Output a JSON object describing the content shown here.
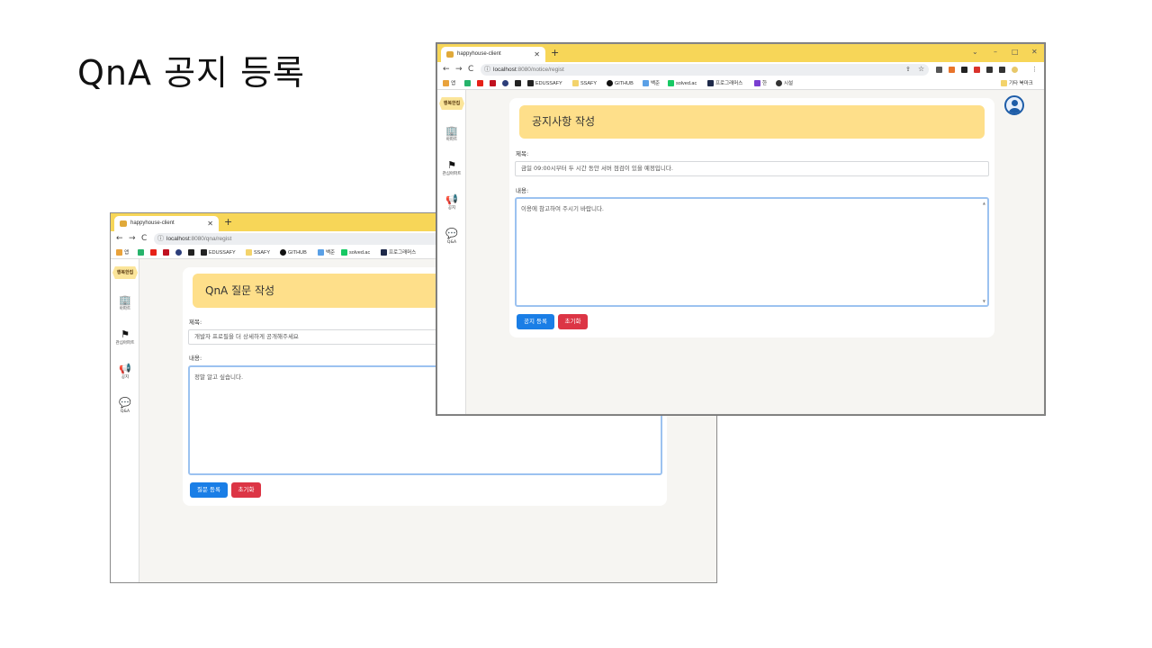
{
  "slide": {
    "title": "QnA 공지 등록"
  },
  "colors": {
    "tab_bar": "#f7d658",
    "card_header": "#fedf8a",
    "primary": "#1a7ee6",
    "danger": "#dc3545",
    "page_bg": "#f6f5f2"
  },
  "qna_window": {
    "tab_title": "happyhouse-client",
    "url_host": "localhost",
    "url_path": ":8080/qna/regist",
    "bookmarks": [
      "앱",
      "EDUSSAFY",
      "SSAFY",
      "GITHUB",
      "백준",
      "solved.ac",
      "프로그래머스"
    ],
    "sidebar": {
      "logo": "행복한집",
      "items": [
        "아파트",
        "관심아파트",
        "공지",
        "Q&A"
      ]
    },
    "form": {
      "header": "QnA 질문 작성",
      "title_label": "제목:",
      "title_value": "개발자 프로필을 더 상세하게 공개해주세요",
      "content_label": "내용:",
      "content_value": "정말 알고 싶습니다.",
      "submit_label": "질문 등록",
      "reset_label": "초기화"
    }
  },
  "notice_window": {
    "tab_title": "happyhouse-client",
    "url_host": "localhost",
    "url_path": ":8080/notice/regist",
    "bookmarks": [
      "앱",
      "EDUSSAFY",
      "SSAFY",
      "GITHUB",
      "백준",
      "solved.ac",
      "프로그래머스",
      "한",
      "시설"
    ],
    "other_bookmarks": "기타 북마크",
    "sidebar": {
      "logo": "행복한집",
      "items": [
        "아파트",
        "관심아파트",
        "공지",
        "Q&A"
      ]
    },
    "form": {
      "header": "공지사항 작성",
      "title_label": "제목:",
      "title_value": "금일 09:00시부터 두 시간 동안 서버 점검이 있을 예정입니다.",
      "content_label": "내용:",
      "content_value": "이용에 참고하여 주시기 바랍니다.",
      "submit_label": "공지 등록",
      "reset_label": "초기화"
    }
  }
}
